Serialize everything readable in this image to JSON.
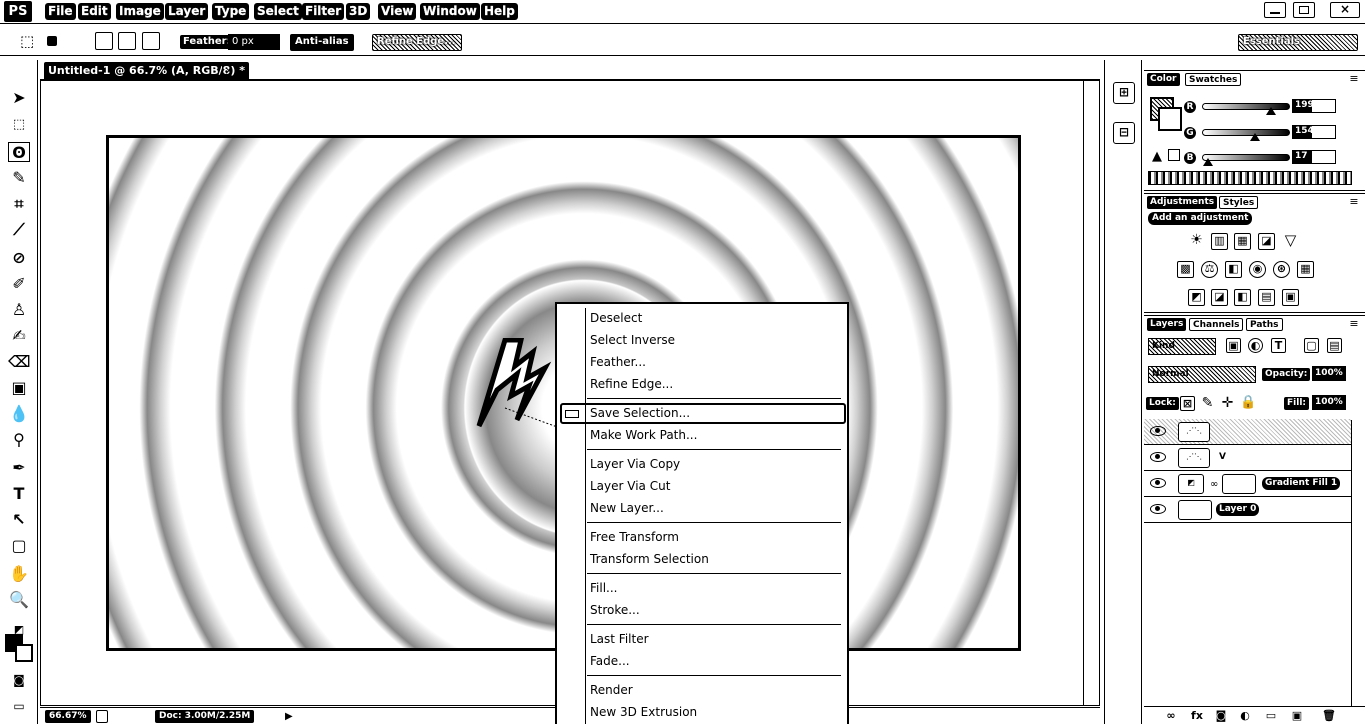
{
  "app": {
    "logo": "PS"
  },
  "menubar": {
    "items": [
      "File",
      "Edit",
      "Image",
      "Layer",
      "Type",
      "Select",
      "Filter",
      "3D",
      "View",
      "Window",
      "Help"
    ]
  },
  "options_bar": {
    "feather_label": "Feather:",
    "feather_value": "0 px",
    "antialias_label": "Anti-alias",
    "refine_edge_label": "Refine Edge...",
    "workspace_label": "Essentials"
  },
  "document": {
    "tab_title": "Untitled-1 @ 66.7% (A, RGB/8) *",
    "close_glyph": "×",
    "zoom": "66.67%",
    "doc_info": "Doc: 3.00M/2.25M"
  },
  "context_menu": {
    "items": [
      "Deselect",
      "Select Inverse",
      "Feather...",
      "Refine Edge...",
      "Save Selection...",
      "Make Work Path...",
      "Layer Via Copy",
      "Layer Via Cut",
      "New Layer...",
      "Free Transform",
      "Transform Selection",
      "Fill...",
      "Stroke...",
      "Last Filter",
      "Fade...",
      "Render",
      "New 3D Extrusion"
    ],
    "highlighted": "Save Selection..."
  },
  "color_panel": {
    "tabs": [
      "Color",
      "Swatches"
    ],
    "channels": [
      {
        "label": "R",
        "value": "199",
        "thumb_fraction": 0.78
      },
      {
        "label": "G",
        "value": "154",
        "thumb_fraction": 0.6
      },
      {
        "label": "B",
        "value": "17",
        "thumb_fraction": 0.07
      }
    ]
  },
  "adjustments_panel": {
    "tabs": [
      "Adjustments",
      "Styles"
    ],
    "add_label": "Add an adjustment"
  },
  "layers_panel": {
    "tabs": [
      "Layers",
      "Channels",
      "Paths"
    ],
    "kind": "Kind",
    "blend_mode": "Normal",
    "opacity_label": "Opacity:",
    "opacity_value": "100%",
    "lock_label": "Lock:",
    "fill_label": "Fill:",
    "fill_value": "100%",
    "layers": [
      {
        "name": "",
        "selected": true
      },
      {
        "name": "V",
        "selected": false
      },
      {
        "name": "Gradient Fill 1",
        "selected": false
      },
      {
        "name": "Layer 0",
        "selected": false
      }
    ]
  }
}
